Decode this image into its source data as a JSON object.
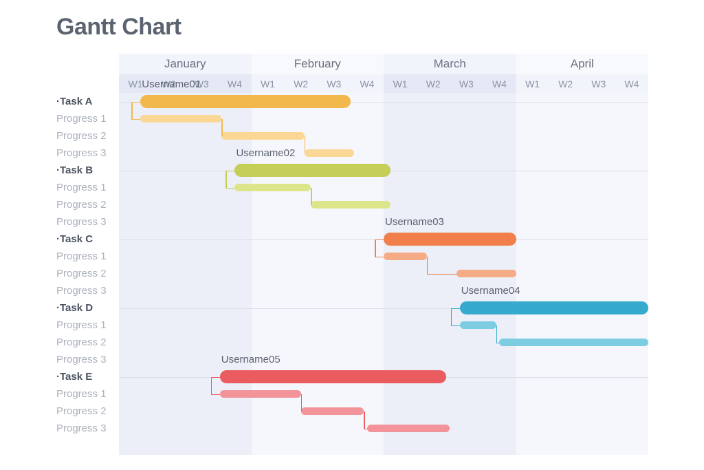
{
  "page": {
    "title": "Gantt Chart"
  },
  "timeline": {
    "months": [
      "January",
      "February",
      "March",
      "April"
    ],
    "weeks": [
      "W1",
      "W2",
      "W3",
      "W4"
    ],
    "week_count_total": 16
  },
  "rows": [
    {
      "label": "·Task A",
      "type": "task"
    },
    {
      "label": "Progress 1",
      "type": "progress"
    },
    {
      "label": "Progress 2",
      "type": "progress"
    },
    {
      "label": "Progress 3",
      "type": "progress"
    },
    {
      "label": "·Task B",
      "type": "task"
    },
    {
      "label": "Progress 1",
      "type": "progress"
    },
    {
      "label": "Progress 2",
      "type": "progress"
    },
    {
      "label": "Progress 3",
      "type": "progress"
    },
    {
      "label": "·Task C",
      "type": "task"
    },
    {
      "label": "Progress 1",
      "type": "progress"
    },
    {
      "label": "Progress 2",
      "type": "progress"
    },
    {
      "label": "Progress 3",
      "type": "progress"
    },
    {
      "label": "·Task D",
      "type": "task"
    },
    {
      "label": "Progress 1",
      "type": "progress"
    },
    {
      "label": "Progress 2",
      "type": "progress"
    },
    {
      "label": "Progress 3",
      "type": "progress"
    },
    {
      "label": "·Task E",
      "type": "task"
    },
    {
      "label": "Progress 1",
      "type": "progress"
    },
    {
      "label": "Progress 2",
      "type": "progress"
    },
    {
      "label": "Progress 3",
      "type": "progress"
    }
  ],
  "colors": {
    "task_a": "#f2b84b",
    "task_a_light": "#fad794",
    "task_b": "#c5ce56",
    "task_b_light": "#dde58b",
    "task_c": "#f07f4b",
    "task_c_light": "#f6ab87",
    "task_d": "#35aacd",
    "task_d_light": "#7dcde2",
    "task_e": "#ea5c60",
    "task_e_light": "#f2949a",
    "month_dark": "#eceef8",
    "month_light": "#f6f7fc",
    "header_week_dark": "#e6e9f5",
    "header_week_light": "#f2f4fb",
    "title_text": "#5b6270",
    "task_text": "#4b5261",
    "progress_text": "#aab0bc",
    "row_separator": "#dcdfe6"
  },
  "chart_data": {
    "type": "bar",
    "title": "Gantt Chart",
    "xlabel": "",
    "ylabel": "",
    "x_units": "weeks",
    "x_axis_categories": [
      "January W1",
      "January W2",
      "January W3",
      "January W4",
      "February W1",
      "February W2",
      "February W3",
      "February W4",
      "March W1",
      "March W2",
      "March W3",
      "March W4",
      "April W1",
      "April W2",
      "April W3",
      "April W4"
    ],
    "xlim": [
      0,
      16
    ],
    "grid": true,
    "legend": "none",
    "tasks": [
      {
        "name": "·Task A",
        "username": "Username01",
        "color": "#f2b84b",
        "sub_color": "#fad794",
        "main": {
          "start_week": 0.65,
          "end_week": 7.0
        },
        "sub_bars": [
          {
            "label": "Progress 1",
            "start_week": 0.65,
            "end_week": 3.1
          },
          {
            "label": "Progress 2",
            "start_week": 3.1,
            "end_week": 5.6
          },
          {
            "label": "Progress 3",
            "start_week": 5.6,
            "end_week": 7.1
          }
        ]
      },
      {
        "name": "·Task B",
        "username": "Username02",
        "color": "#c5ce56",
        "sub_color": "#dde58b",
        "main": {
          "start_week": 3.5,
          "end_week": 8.2
        },
        "sub_bars": [
          {
            "label": "Progress 1",
            "start_week": 3.5,
            "end_week": 5.8
          },
          {
            "label": "Progress 2",
            "start_week": 5.8,
            "end_week": 8.2
          }
        ]
      },
      {
        "name": "·Task C",
        "username": "Username03",
        "color": "#f07f4b",
        "sub_color": "#f6ab87",
        "main": {
          "start_week": 8.0,
          "end_week": 12.0
        },
        "sub_bars": [
          {
            "label": "Progress 1",
            "start_week": 8.0,
            "end_week": 9.3
          },
          {
            "label": "Progress 2",
            "start_week": 10.2,
            "end_week": 12.0
          }
        ]
      },
      {
        "name": "·Task D",
        "username": "Username04",
        "color": "#35aacd",
        "sub_color": "#7dcde2",
        "main": {
          "start_week": 10.3,
          "end_week": 16.0
        },
        "sub_bars": [
          {
            "label": "Progress 1",
            "start_week": 10.3,
            "end_week": 11.4
          },
          {
            "label": "Progress 2",
            "start_week": 11.5,
            "end_week": 16.0
          }
        ]
      },
      {
        "name": "·Task E",
        "username": "Username05",
        "color": "#ea5c60",
        "sub_color": "#f2949a",
        "main": {
          "start_week": 3.05,
          "end_week": 9.9
        },
        "sub_bars": [
          {
            "label": "Progress 1",
            "start_week": 3.05,
            "end_week": 5.5
          },
          {
            "label": "Progress 2",
            "start_week": 5.5,
            "end_week": 7.4
          },
          {
            "label": "Progress 3",
            "start_week": 7.5,
            "end_week": 10.0
          }
        ]
      }
    ]
  }
}
